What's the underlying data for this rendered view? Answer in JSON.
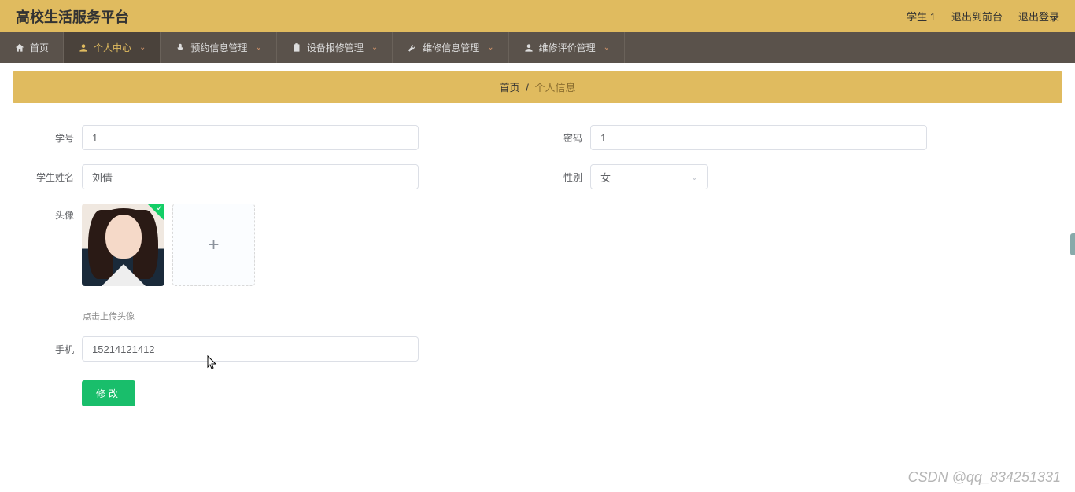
{
  "header": {
    "title": "高校生活服务平台",
    "user": "学生 1",
    "front_link": "退出到前台",
    "logout": "退出登录"
  },
  "nav": [
    {
      "icon": "home-icon",
      "label": "首页",
      "dropdown": false
    },
    {
      "icon": "user-icon",
      "label": "个人中心",
      "dropdown": true,
      "active": true
    },
    {
      "icon": "mic-icon",
      "label": "预约信息管理",
      "dropdown": true
    },
    {
      "icon": "clipboard-icon",
      "label": "设备报修管理",
      "dropdown": true
    },
    {
      "icon": "wrench-icon",
      "label": "维修信息管理",
      "dropdown": true
    },
    {
      "icon": "user-alt-icon",
      "label": "维修评价管理",
      "dropdown": true
    }
  ],
  "breadcrumb": {
    "home": "首页",
    "sep": "/",
    "current": "个人信息"
  },
  "form": {
    "student_id": {
      "label": "学号",
      "value": "1"
    },
    "password": {
      "label": "密码",
      "value": "1"
    },
    "name": {
      "label": "学生姓名",
      "value": "刘倩"
    },
    "gender": {
      "label": "性别",
      "value": "女"
    },
    "avatar": {
      "label": "头像",
      "hint": "点击上传头像"
    },
    "phone": {
      "label": "手机",
      "value": "15214121412"
    },
    "submit": "修改"
  },
  "watermark": "CSDN @qq_834251331"
}
